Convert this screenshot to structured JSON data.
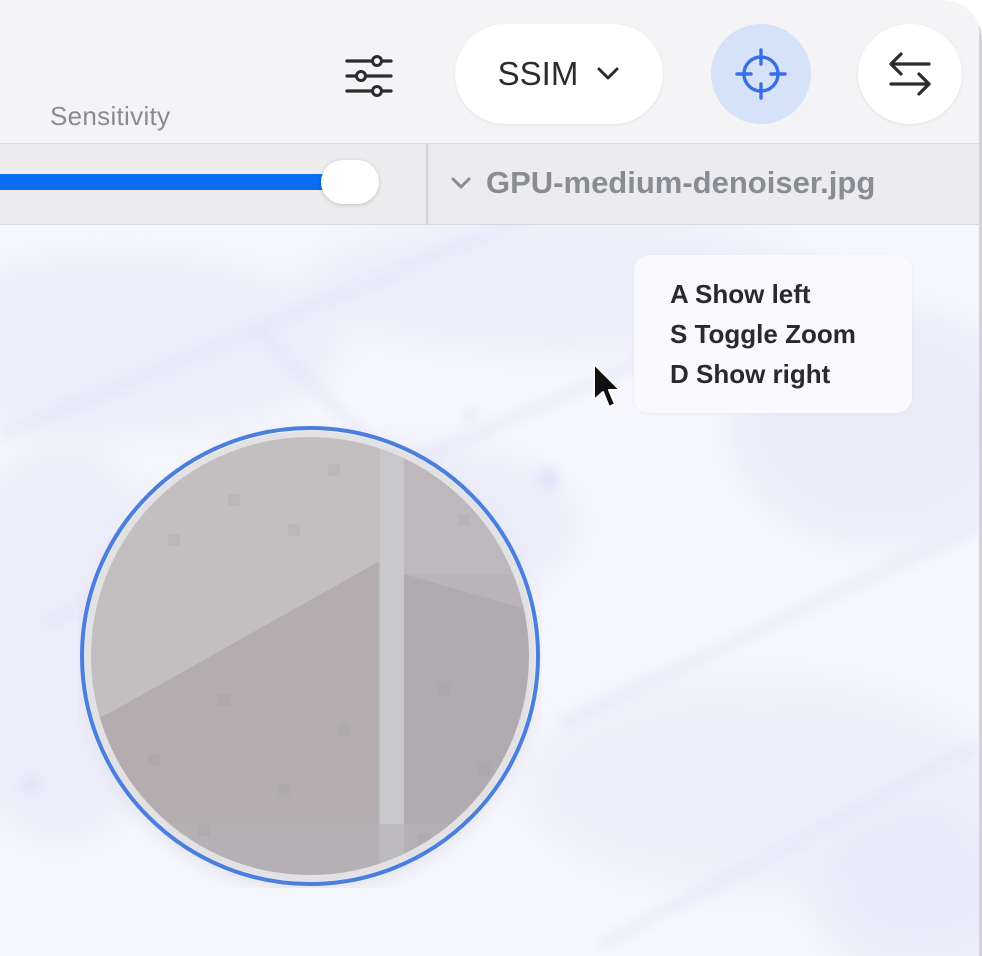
{
  "toolbar": {
    "sensitivity_label": "Sensitivity",
    "adjust_icon": "sliders-icon",
    "metric": {
      "selected": "SSIM",
      "icon": "chevron-down-icon"
    },
    "target_icon": "crosshair-icon",
    "swap_icon": "swap-arrows-icon"
  },
  "sensitivity": {
    "value_percent": 83
  },
  "file": {
    "name": "GPU-medium-denoiser.jpg",
    "icon": "chevron-down-icon"
  },
  "shortcuts": [
    {
      "label": "A Show left"
    },
    {
      "label": "S Toggle Zoom"
    },
    {
      "label": "D Show right"
    }
  ],
  "colors": {
    "accent": "#0a6cf0",
    "target_bg": "#d6e2f8",
    "target_icon": "#3a6ee8",
    "loupe_ring": "#4a7fde"
  }
}
